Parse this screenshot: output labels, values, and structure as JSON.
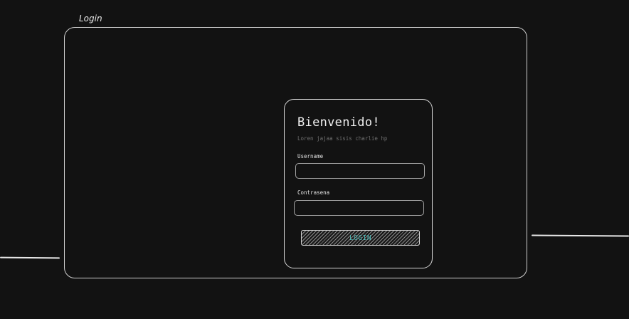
{
  "frame": {
    "label": "Login"
  },
  "card": {
    "title": "Bienvenido!",
    "subtitle": "Loren jajaa sisis charlie hp",
    "username": {
      "label": "Username",
      "value": "",
      "placeholder": ""
    },
    "password": {
      "label": "Contrasena",
      "value": "",
      "placeholder": ""
    },
    "login_label": "LOGIN"
  },
  "colors": {
    "background": "#121212",
    "stroke": "#d6d6d6",
    "accent": "#4fb7b5",
    "muted_text": "#6f6f6f"
  }
}
